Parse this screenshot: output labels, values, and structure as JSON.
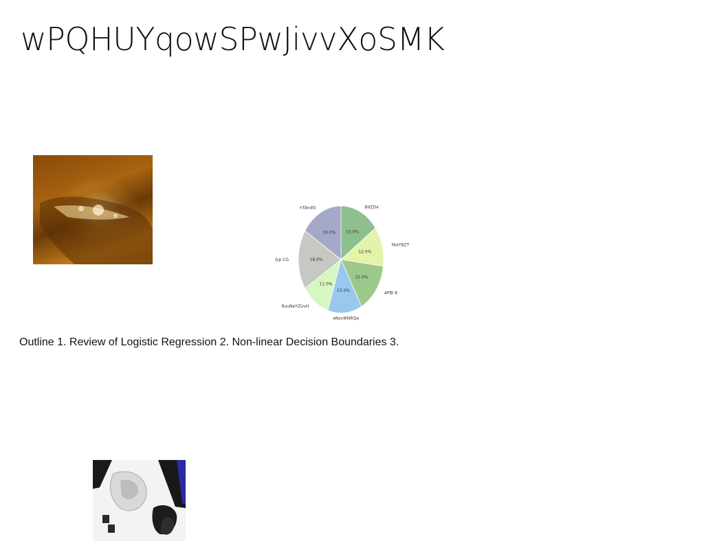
{
  "title": "wPQHUYqowSPwJivvXoSMK",
  "caption": "Outline 1. Review of Logistic Regression 2. Non-linear Decision Boundaries 3.",
  "chart_data": {
    "type": "pie",
    "title": "",
    "slices": [
      {
        "label": "BdZDx",
        "value": 15.0,
        "color": "#8dbf8f"
      },
      {
        "label": "NIaYBZT",
        "value": 12.0,
        "color": "#e3f3a8"
      },
      {
        "label": "APBI K",
        "value": 15.0,
        "color": "#9cc98b"
      },
      {
        "label": "eNzvIKNRQa",
        "value": 13.0,
        "color": "#98c8ee"
      },
      {
        "label": "RuuNeYZUvH",
        "value": 11.0,
        "color": "#d6f7c0"
      },
      {
        "label": "Ilyp CG",
        "value": 18.0,
        "color": "#c6c8c2"
      },
      {
        "label": "nTAndO",
        "value": 16.0,
        "color": "#a4a9c9"
      }
    ]
  }
}
